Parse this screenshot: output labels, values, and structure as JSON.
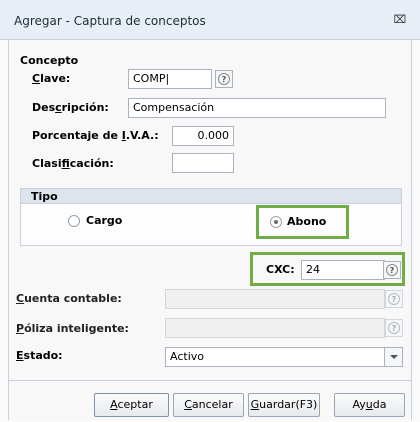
{
  "window": {
    "title": "Agregar - Captura de conceptos",
    "close_glyph": "⌧"
  },
  "concepto": {
    "section_title": "Concepto",
    "clave": {
      "label_pre": "",
      "label_u": "C",
      "label_post": "lave:",
      "value": "COMP|"
    },
    "descripcion": {
      "label_pre": "Des",
      "label_u": "c",
      "label_post": "ripción:",
      "value": "Compensación"
    },
    "porcentaje_iva": {
      "label_pre": "Porcentaje de ",
      "label_u": "I",
      "label_post": ".V.A.:",
      "value": "0.000"
    },
    "clasificacion": {
      "label_pre": "Clasi",
      "label_u": "f",
      "label_post": "icación:",
      "value": ""
    }
  },
  "tipo": {
    "title": "Tipo",
    "options": [
      {
        "label": "Cargo",
        "checked": false
      },
      {
        "label": "Abono",
        "checked": true
      }
    ]
  },
  "cxc": {
    "label": "CXC:",
    "value": "24"
  },
  "cuenta_contable": {
    "label_pre": "",
    "label_u": "C",
    "label_post": "uenta contable:",
    "value": ""
  },
  "poliza_inteligente": {
    "label_pre": "",
    "label_u": "P",
    "label_post": "óliza inteligente:",
    "value": ""
  },
  "estado": {
    "label_pre": "",
    "label_u": "E",
    "label_post": "stado:",
    "value": "Activo"
  },
  "buttons": {
    "aceptar": {
      "pre": "",
      "u": "A",
      "post": "ceptar"
    },
    "cancelar": {
      "pre": "",
      "u": "C",
      "post": "ancelar"
    },
    "guardar": {
      "pre": "",
      "u": "G",
      "post": "uardar(F3)"
    },
    "ayuda": {
      "pre": "Ay",
      "u": "u",
      "post": "da"
    }
  },
  "highlight_color": "#70ad47",
  "help_icon_glyph": "?"
}
